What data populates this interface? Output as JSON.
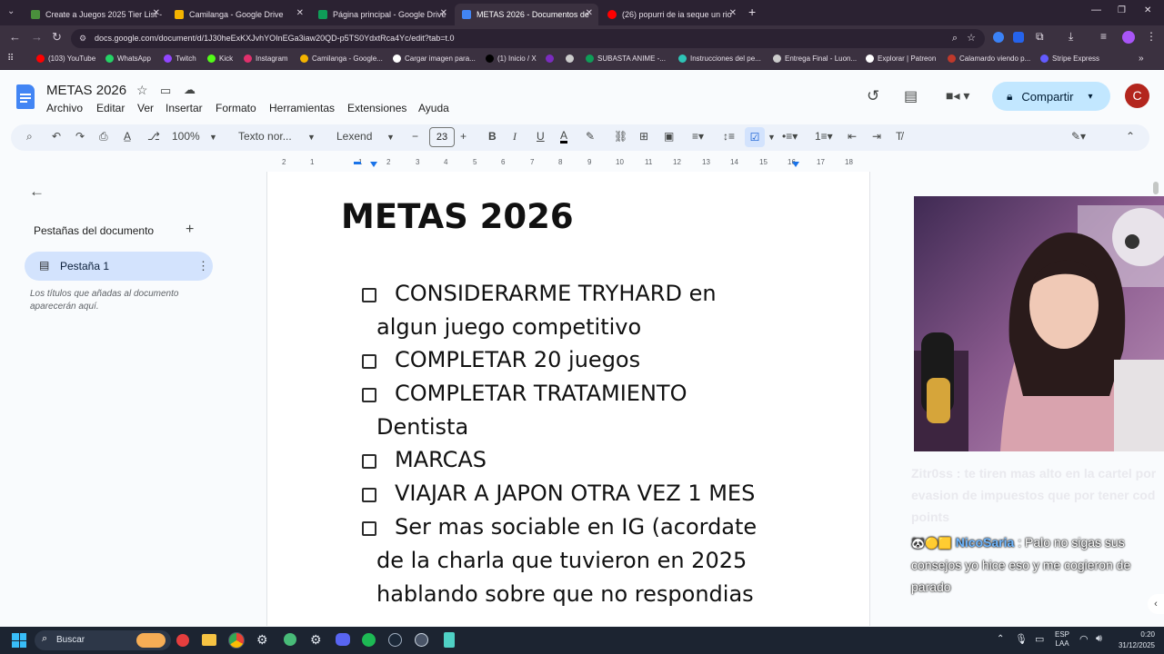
{
  "browser": {
    "tabs": [
      {
        "title": "Create a Juegos 2025 Tier List -",
        "color": "#4a8f3c"
      },
      {
        "title": "Camilanga - Google Drive",
        "color": "#f4b400"
      },
      {
        "title": "Página principal - Google Drive",
        "color": "#0f9d58"
      },
      {
        "title": "METAS 2026 - Documentos de",
        "color": "#4285f4"
      },
      {
        "title": "(26) popurri de ia seque un rio",
        "color": "#ff0000"
      }
    ],
    "url": "docs.google.com/document/d/1J30heExKXJvhYOInEGa3iaw20QD-p5TS0YdxtRca4Yc/edit?tab=t.0",
    "bookmarks": [
      {
        "label": "(103) YouTube",
        "color": "#ff0000"
      },
      {
        "label": "WhatsApp",
        "color": "#25d366"
      },
      {
        "label": "Twitch",
        "color": "#9146ff"
      },
      {
        "label": "Kick",
        "color": "#53fc18"
      },
      {
        "label": "Instagram",
        "color": "#e1306c"
      },
      {
        "label": "Camilanga - Google...",
        "color": "#f4b400"
      },
      {
        "label": "Cargar imagen para...",
        "color": "#ffffff"
      },
      {
        "label": "(1) Inicio / X",
        "color": "#000000"
      },
      {
        "label": "",
        "color": "#7b2cbf"
      },
      {
        "label": "",
        "color": "#cccccc"
      },
      {
        "label": "SUBASTA ANIME -...",
        "color": "#0f9d58"
      },
      {
        "label": "Instrucciones del pe...",
        "color": "#2ec4b6"
      },
      {
        "label": "Entrega Final - Luon...",
        "color": "#cccccc"
      },
      {
        "label": "Explorar | Patreon",
        "color": "#ffffff"
      },
      {
        "label": "Calamardo viendo p...",
        "color": "#c0392b"
      },
      {
        "label": "Stripe Express",
        "color": "#635bff"
      }
    ]
  },
  "docs": {
    "title": "METAS 2026",
    "menu": [
      "Archivo",
      "Editar",
      "Ver",
      "Insertar",
      "Formato",
      "Herramientas",
      "Extensiones",
      "Ayuda"
    ],
    "share_label": "Compartir",
    "avatar_letter": "C",
    "toolbar": {
      "zoom": "100%",
      "style": "Texto nor...",
      "font": "Lexend",
      "font_size": "23"
    },
    "ruler_ticks": [
      "2",
      "1",
      "1",
      "2",
      "3",
      "4",
      "5",
      "6",
      "7",
      "8",
      "9",
      "10",
      "11",
      "12",
      "13",
      "14",
      "15",
      "16",
      "17",
      "18"
    ],
    "sidebar": {
      "heading": "Pestañas del documento",
      "tab_label": "Pestaña 1",
      "hint": "Los títulos que añadas al documento aparecerán aquí."
    },
    "heading": "METAS 2026",
    "items": [
      {
        "lines": [
          "CONSIDERARME TRYHARD en",
          "algun juego competitivo"
        ]
      },
      {
        "lines": [
          "COMPLETAR 20 juegos"
        ]
      },
      {
        "lines": [
          "COMPLETAR TRATAMIENTO",
          "Dentista"
        ]
      },
      {
        "lines": [
          "MARCAS"
        ]
      },
      {
        "lines": [
          "VIAJAR A JAPON OTRA VEZ 1 MES"
        ]
      },
      {
        "lines": [
          "Ser mas sociable en IG (acordate",
          "de la charla que tuvieron en 2025",
          "hablando sobre que no respondias"
        ]
      }
    ]
  },
  "stream_chat": [
    {
      "user": "Zitr0ss",
      "text": "te tiren mas alto en la cartel por evasion de impuestos que por tener cod points",
      "faded": true
    },
    {
      "user": "NicoSaria",
      "text": "Palo no sigas sus consejos yo hice eso y me cogieron de parado",
      "faded": false
    }
  ],
  "taskbar": {
    "search_placeholder": "Buscar",
    "lang_line1": "ESP",
    "lang_line2": "LAA",
    "time": "0:20",
    "date": "31/12/2025"
  }
}
